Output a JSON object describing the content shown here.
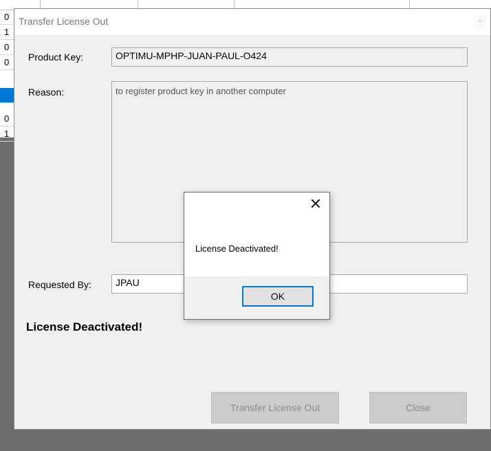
{
  "dialog": {
    "title": "Transfer License Out",
    "close_glyph": "×",
    "product_key_label": "Product Key:",
    "product_key_value": "OPTIMU-MPHP-JUAN-PAUL-O424",
    "reason_label": "Reason:",
    "reason_value": "to register product key in another computer",
    "requested_by_label": "Requested By:",
    "requested_by_value": "JPAU",
    "status_message": "License Deactivated!",
    "transfer_button": "Transfer License Out",
    "close_button": "Close"
  },
  "message_box": {
    "text": "License Deactivated!",
    "ok_label": "OK",
    "close_glyph": "✕"
  },
  "background_rows": [
    "0",
    "1",
    "0",
    "0",
    "",
    "0",
    "1"
  ],
  "colors": {
    "selection": "#0078d7",
    "ok_border": "#0078d7"
  }
}
